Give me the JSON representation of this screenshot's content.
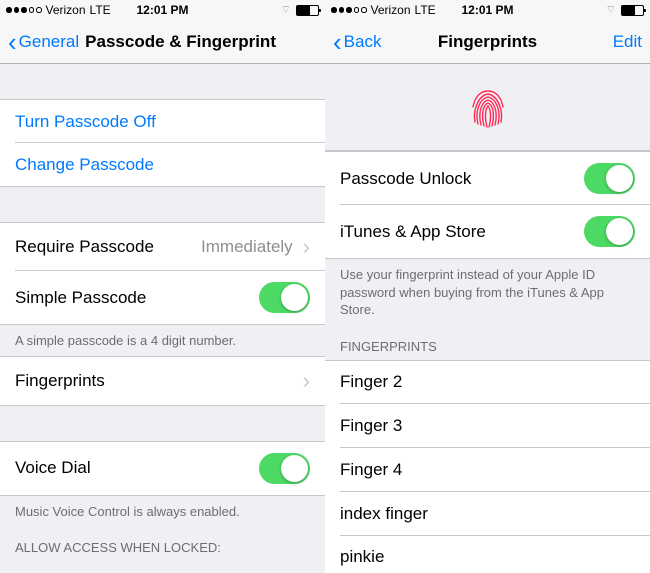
{
  "status": {
    "carrier": "Verizon",
    "network": "LTE",
    "time": "12:01 PM"
  },
  "left": {
    "nav": {
      "back": "General",
      "title": "Passcode & Fingerprint"
    },
    "turn_off": "Turn Passcode Off",
    "change": "Change Passcode",
    "require": {
      "label": "Require Passcode",
      "value": "Immediately"
    },
    "simple": "Simple Passcode",
    "simple_footer": "A simple passcode is a 4 digit number.",
    "fingerprints": "Fingerprints",
    "voice_dial": "Voice Dial",
    "voice_footer": "Music Voice Control is always enabled.",
    "allow_header": "Allow Access When Locked:"
  },
  "right": {
    "nav": {
      "back": "Back",
      "title": "Fingerprints",
      "edit": "Edit"
    },
    "passcode_unlock": "Passcode Unlock",
    "itunes": "iTunes & App Store",
    "itunes_footer": "Use your fingerprint instead of your Apple ID password when buying from the iTunes & App Store.",
    "fp_header": "Fingerprints",
    "fingers": [
      "Finger 2",
      "Finger 3",
      "Finger 4",
      "index finger",
      "pinkie"
    ]
  }
}
